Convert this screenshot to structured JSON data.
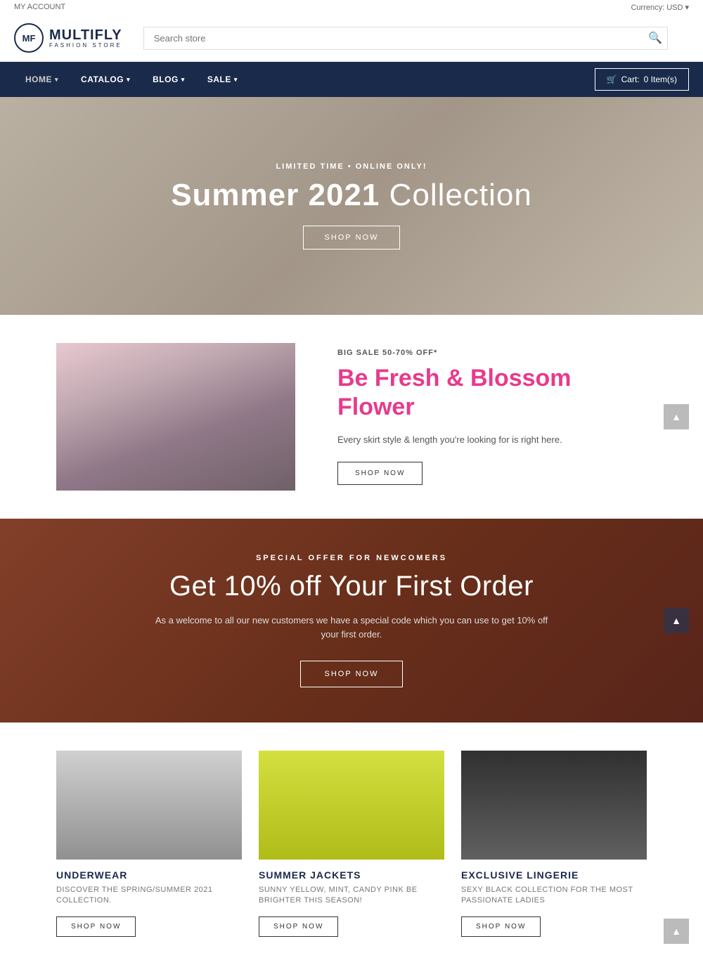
{
  "topbar": {
    "left": "MY ACCOUNT",
    "right": "Currency: USD ▾"
  },
  "header": {
    "logo_letters": "MF",
    "logo_main": "MULTIFLY",
    "logo_sub": "FASHION STORE",
    "search_placeholder": "Search store"
  },
  "navbar": {
    "items": [
      {
        "label": "HOME",
        "has_arrow": true
      },
      {
        "label": "CATALOG",
        "has_arrow": true
      },
      {
        "label": "BLOG",
        "has_arrow": true
      },
      {
        "label": "SALE",
        "has_arrow": true
      }
    ],
    "cart_label": "Cart:",
    "cart_count": "0 Item(s)"
  },
  "hero": {
    "sub": "LIMITED TIME • ONLINE ONLY!",
    "title_bold": "Summer 2021",
    "title_light": "Collection",
    "cta": "SHOP NOW"
  },
  "blossom": {
    "sale_badge": "BIG SALE 50-70% OFF*",
    "title_line1": "Be Fresh & Blossom",
    "title_line2": "Flower",
    "description": "Every skirt style & length you're looking for is right here.",
    "cta": "SHOP NOW"
  },
  "promo": {
    "sub": "SPECIAL OFFER FOR NEWCOMERS",
    "title": "Get 10% off Your First Order",
    "description": "As a welcome to all our new customers we have a special code which you can use to get 10% off your first order.",
    "cta": "SHOP NOW"
  },
  "products": [
    {
      "category": "UNDERWEAR",
      "description": "DISCOVER THE SPRING/SUMMER 2021 COLLECTION.",
      "cta": "SHOP NOW",
      "img_class": "product-img-underwear"
    },
    {
      "category": "SUMMER JACKETS",
      "description": "SUNNY YELLOW, MINT, CANDY PINK BE BRIGHTER THIS SEASON!",
      "cta": "SHOP NOW",
      "img_class": "product-img-jackets"
    },
    {
      "category": "EXCLUSIVE LINGERIE",
      "description": "SEXY BLACK COLLECTION FOR THE MOST PASSIONATE LADIES",
      "cta": "SHOP NOW",
      "img_class": "product-img-lingerie"
    }
  ],
  "scroll_up_arrow": "▲"
}
